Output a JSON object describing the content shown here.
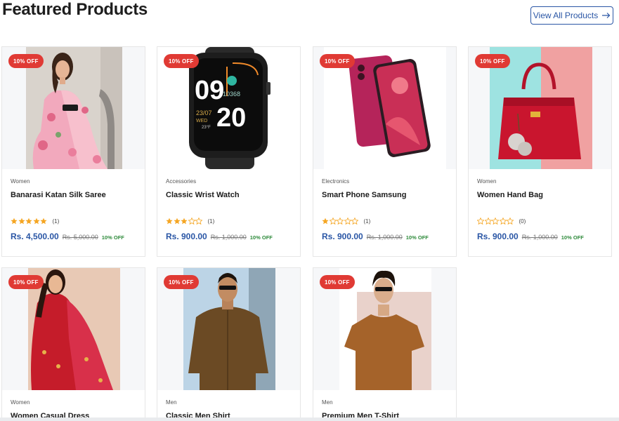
{
  "section": {
    "title": "Featured Products",
    "view_all_label": "View All Products"
  },
  "colors": {
    "accent": "#2a56a5",
    "badge": "#e03a34",
    "off_text": "#2d8a3a",
    "star": "#f5a623"
  },
  "products": [
    {
      "badge": "10% OFF",
      "category": "Women",
      "name": "Banarasi Katan Silk Saree",
      "rating": 5,
      "reviews": "(1)",
      "price": "Rs. 4,500.00",
      "old_price": "Rs. 5,000.00",
      "off": "10% OFF"
    },
    {
      "badge": "10% OFF",
      "category": "Accessories",
      "name": "Classic Wrist Watch",
      "rating": 3,
      "reviews": "(1)",
      "price": "Rs. 900.00",
      "old_price": "Rs. 1,000.00",
      "off": "10% OFF",
      "watch_face": {
        "h": "09",
        "m": "20",
        "date": "23/07",
        "day": "WED",
        "temp": "23°F",
        "steps": "10368"
      }
    },
    {
      "badge": "10% OFF",
      "category": "Electronics",
      "name": "Smart Phone Samsung",
      "rating": 1,
      "reviews": "(1)",
      "price": "Rs. 900.00",
      "old_price": "Rs. 1,000.00",
      "off": "10% OFF"
    },
    {
      "badge": "10% OFF",
      "category": "Women",
      "name": "Women Hand Bag",
      "rating": 0,
      "reviews": "(0)",
      "price": "Rs. 900.00",
      "old_price": "Rs. 1,000.00",
      "off": "10% OFF"
    },
    {
      "badge": "10% OFF",
      "category": "Women",
      "name": "Women Casual Dress"
    },
    {
      "badge": "10% OFF",
      "category": "Men",
      "name": "Classic Men Shirt"
    },
    {
      "badge": "10% OFF",
      "category": "Men",
      "name": "Premium Men T-Shirt"
    }
  ]
}
